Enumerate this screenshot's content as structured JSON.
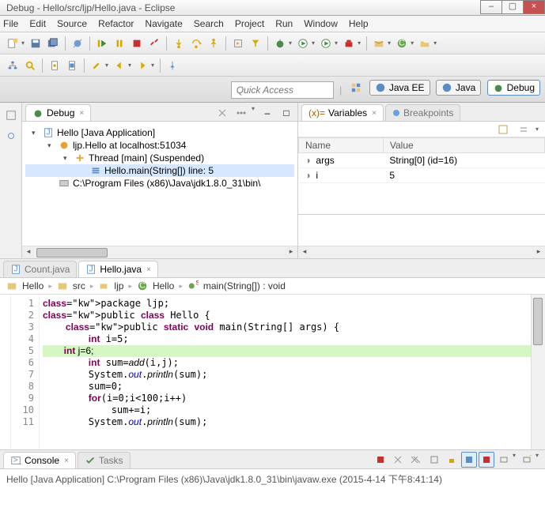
{
  "window_title": "Debug - Hello/src/ljp/Hello.java - Eclipse",
  "menu": [
    "File",
    "Edit",
    "Source",
    "Refactor",
    "Navigate",
    "Search",
    "Project",
    "Run",
    "Window",
    "Help"
  ],
  "quick_access_placeholder": "Quick Access",
  "perspectives": [
    "Java EE",
    "Java",
    "Debug"
  ],
  "debug_view": {
    "title": "Debug",
    "tree": [
      {
        "indent": 0,
        "twist": "▾",
        "icon": "java-app",
        "text": "Hello [Java Application]"
      },
      {
        "indent": 1,
        "twist": "▾",
        "icon": "vm",
        "text": "ljp.Hello at localhost:51034"
      },
      {
        "indent": 2,
        "twist": "▾",
        "icon": "thread",
        "text": "Thread [main] (Suspended)"
      },
      {
        "indent": 3,
        "twist": "",
        "icon": "stack",
        "text": "Hello.main(String[]) line: 5",
        "selected": true
      },
      {
        "indent": 1,
        "twist": "",
        "icon": "proc",
        "text": "C:\\Program Files (x86)\\Java\\jdk1.8.0_31\\bin\\"
      }
    ]
  },
  "variables_view": {
    "tabs": [
      "Variables",
      "Breakpoints"
    ],
    "columns": [
      "Name",
      "Value"
    ],
    "rows": [
      {
        "name": "args",
        "value": "String[0]  (id=16)"
      },
      {
        "name": "i",
        "value": "5"
      }
    ]
  },
  "editor": {
    "tabs": [
      {
        "label": "Count.java",
        "active": false
      },
      {
        "label": "Hello.java",
        "active": true
      }
    ],
    "breadcrumb": [
      "Hello",
      "src",
      "ljp",
      "Hello",
      "main(String[]) : void"
    ],
    "lines": [
      "package ljp;",
      "public class Hello {",
      "    public static void main(String[] args) {",
      "        int i=5;",
      "        int j=6;",
      "        int sum=add(i,j);",
      "        System.out.println(sum);",
      "        sum=0;",
      "        for(i=0;i<100;i++)",
      "            sum+=i;",
      "        System.out.println(sum);"
    ],
    "current_line": 5
  },
  "console": {
    "tabs": [
      "Console",
      "Tasks"
    ],
    "text": "Hello [Java Application] C:\\Program Files (x86)\\Java\\jdk1.8.0_31\\bin\\javaw.exe (2015-4-14 下午8:41:14)"
  }
}
